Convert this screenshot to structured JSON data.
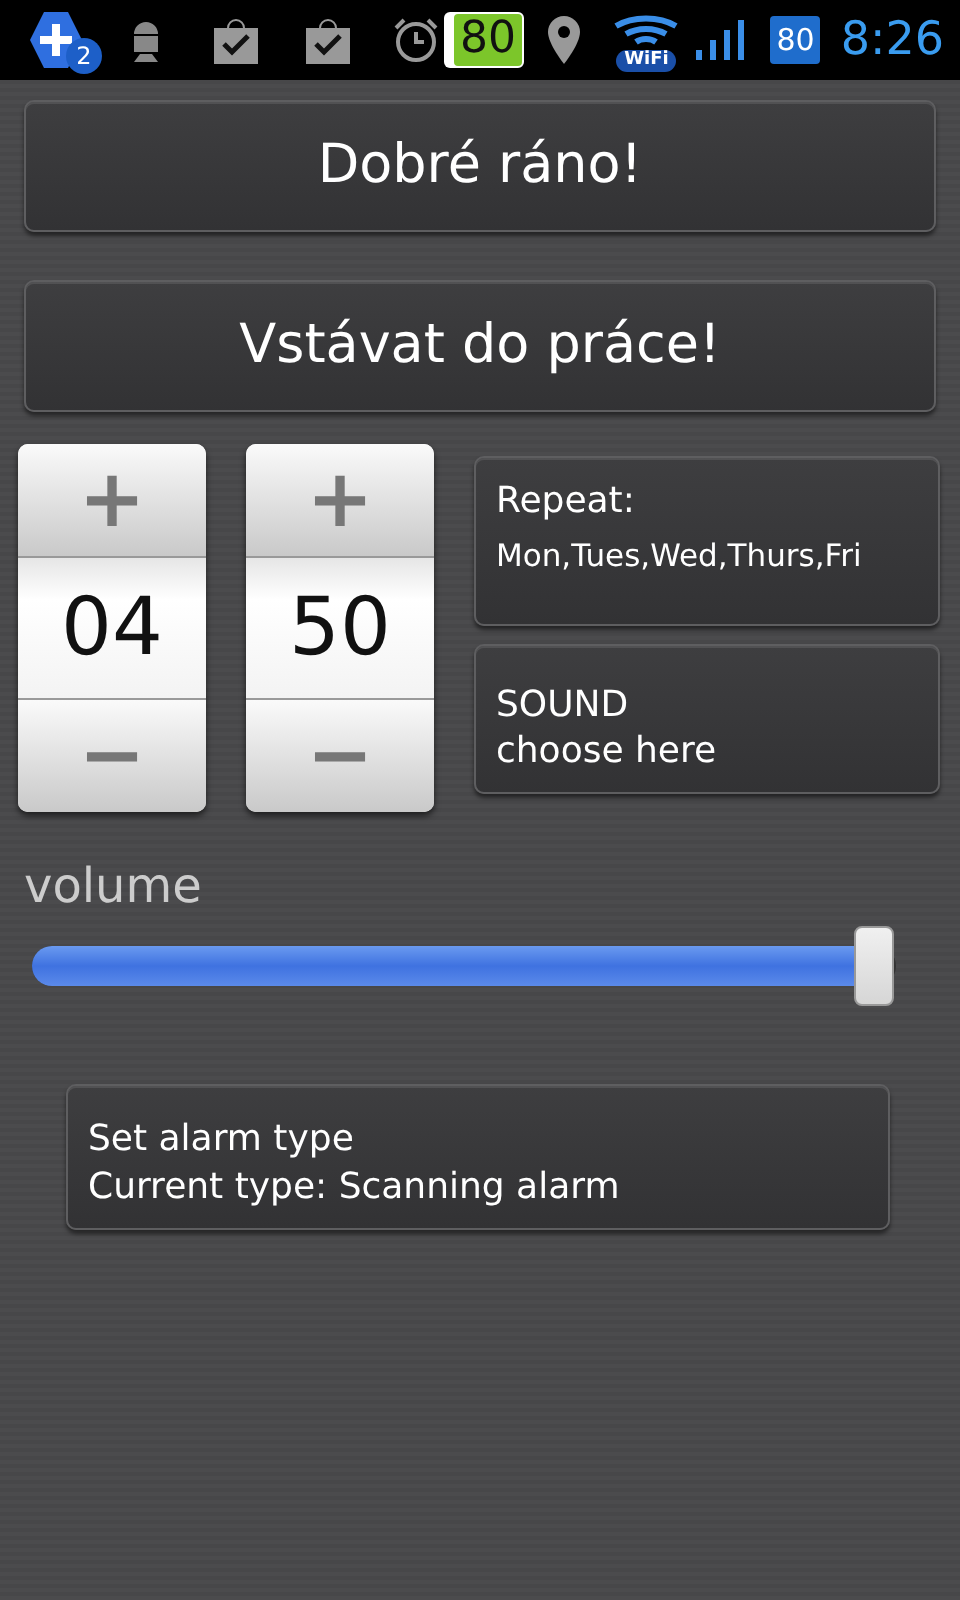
{
  "status_bar": {
    "notification_count": "2",
    "battery_badge": "80",
    "wifi_label": "WiFi",
    "battery_level_badge": "80",
    "time": "8:26"
  },
  "buttons": [
    "Dobré ráno!",
    "Vstávat do práce!"
  ],
  "time_pickers": [
    {
      "value": "04",
      "plus": "+",
      "minus": "−"
    },
    {
      "value": "50",
      "plus": "+",
      "minus": "−"
    }
  ],
  "repeat": {
    "title": "Repeat:",
    "days": "Mon,Tues,Wed,Thurs,Fri"
  },
  "sound": {
    "title": "SOUND",
    "subtitle": "choose here"
  },
  "volume": {
    "label": "volume",
    "level": 0.98
  },
  "alarm_type": {
    "title": "Set alarm type",
    "current": "Current type: Scanning alarm"
  }
}
